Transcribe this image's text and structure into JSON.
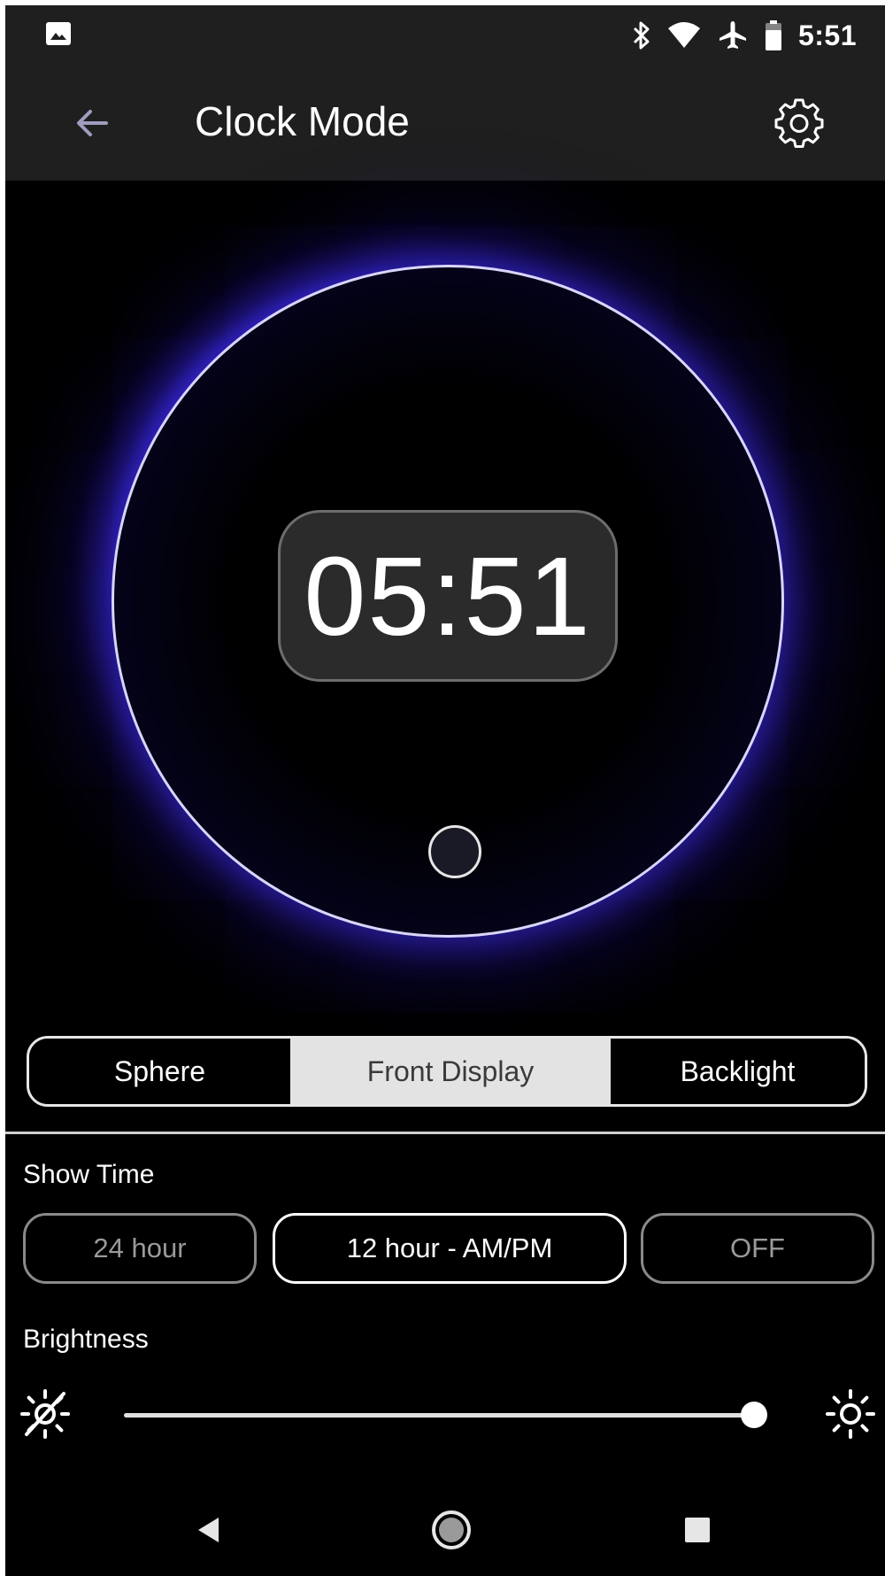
{
  "status_bar": {
    "time": "5:51",
    "icons": [
      "image-icon",
      "bluetooth-icon",
      "wifi-icon",
      "airplane-icon",
      "battery-icon"
    ]
  },
  "app_bar": {
    "title": "Clock Mode",
    "back_icon": "arrow-left-icon",
    "settings_icon": "gear-icon"
  },
  "sphere": {
    "time": "05:51",
    "glow_color": "#4a32ff"
  },
  "display_tabs": [
    {
      "label": "Sphere",
      "selected": false
    },
    {
      "label": "Front Display",
      "selected": true
    },
    {
      "label": "Backlight",
      "selected": false
    }
  ],
  "show_time": {
    "label": "Show Time",
    "options": [
      {
        "label": "24 hour",
        "selected": false
      },
      {
        "label": "12 hour - AM/PM",
        "selected": true
      },
      {
        "label": "OFF",
        "selected": false
      }
    ]
  },
  "brightness": {
    "label": "Brightness",
    "value_percent": 100,
    "low_icon": "brightness-off-icon",
    "high_icon": "brightness-high-icon"
  },
  "nav_bar": {
    "icons": [
      "nav-back-icon",
      "nav-home-icon",
      "nav-recents-icon"
    ]
  },
  "colors": {
    "background": "#000000",
    "bar": "#1f1f1f",
    "selected_tab": "#e3e3e3",
    "accent_glow": "#4a32ff"
  }
}
